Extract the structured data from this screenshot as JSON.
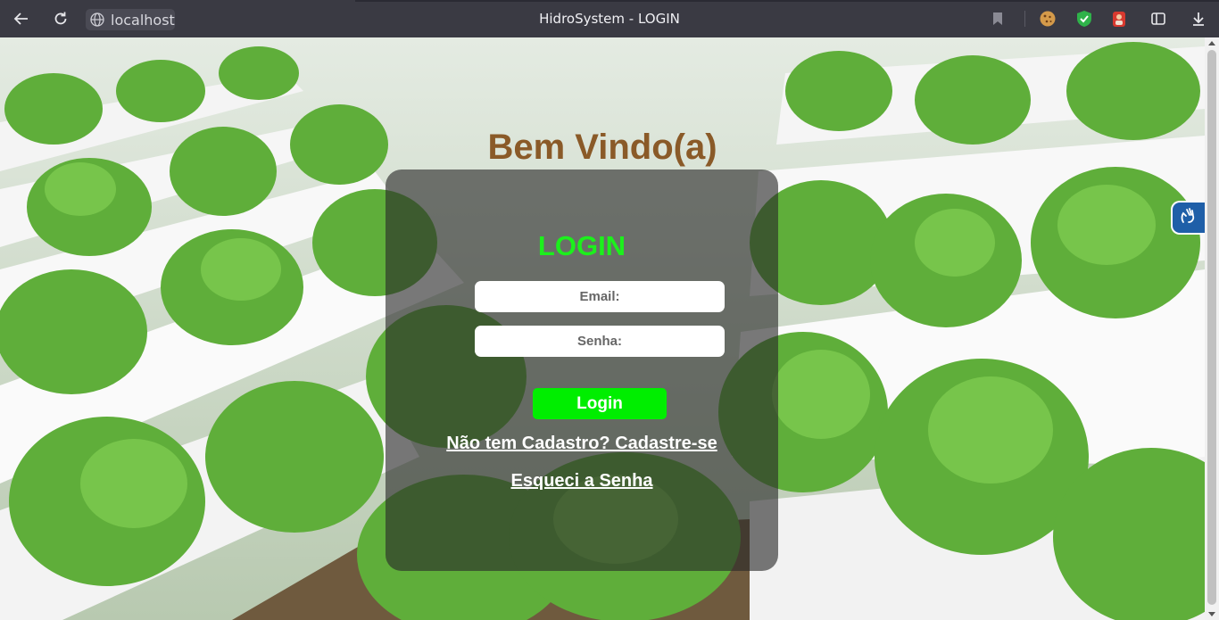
{
  "browser": {
    "window_title": "HidroSystem - LOGIN",
    "url_host": "localhost",
    "icons": [
      "back-arrow-icon",
      "reload-icon",
      "globe-icon",
      "bookmark-icon",
      "cookie-extension-icon",
      "shield-extension-icon",
      "avatar-extension-icon",
      "tab-search-icon",
      "download-icon"
    ]
  },
  "page": {
    "welcome": "Bem Vindo(a)",
    "login_title": "LOGIN",
    "email_placeholder": "Email:",
    "senha_placeholder": "Senha:",
    "login_button": "Login",
    "signup_link": "Não tem Cadastro? Cadastre-se",
    "forgot_link": "Esqueci a Senha"
  },
  "accessibility_widget": {
    "icon": "sign-language-hands-icon"
  },
  "colors": {
    "welcome_text": "#8a5a28",
    "login_title": "#1cf01c",
    "login_button": "#00ee00",
    "card_overlay": "rgba(40,40,40,0.62)",
    "chrome_bg": "#3a3a43",
    "a11y_widget": "#1f5fa8"
  }
}
